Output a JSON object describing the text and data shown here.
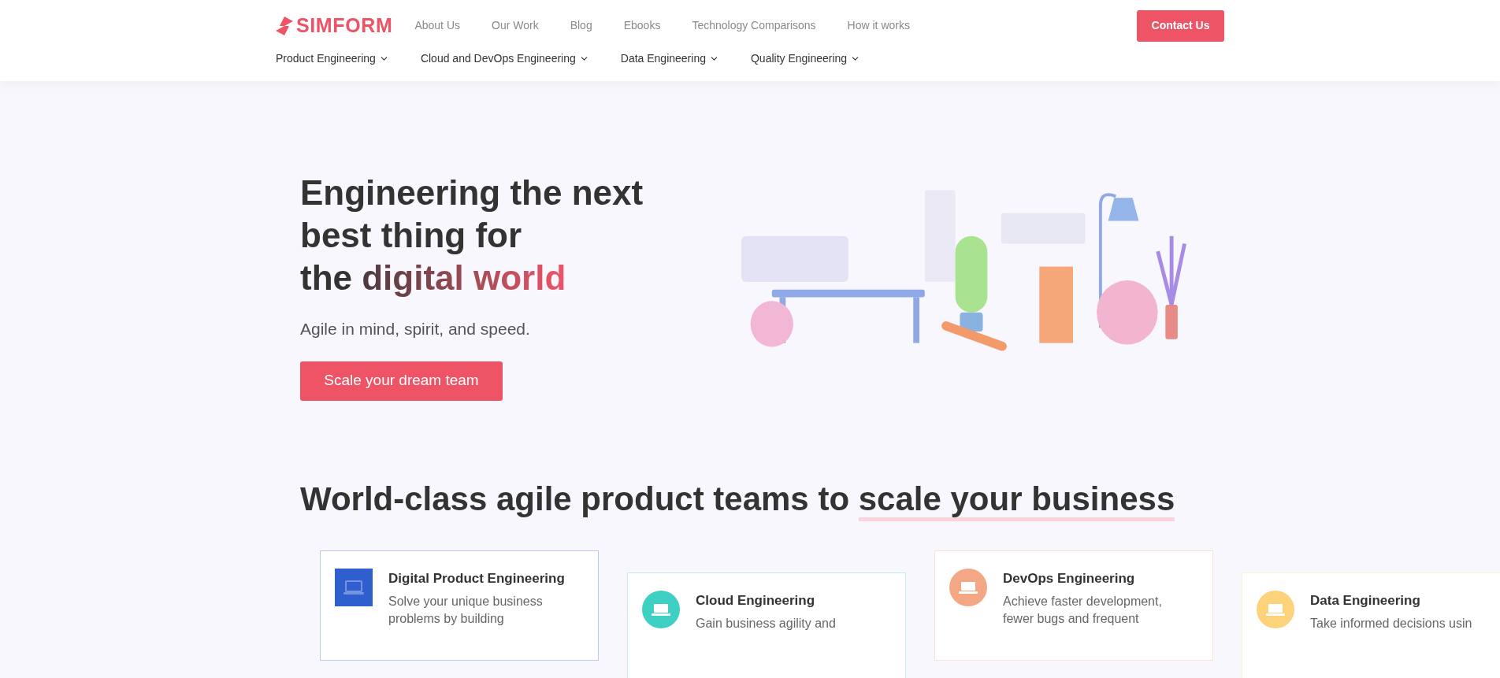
{
  "header": {
    "logo": "SIMFORM",
    "top_links": [
      "About Us",
      "Our Work",
      "Blog",
      "Ebooks",
      "Technology Comparisons",
      "How it works"
    ],
    "cta": "Contact Us",
    "menus": [
      "Product Engineering",
      "Cloud and DevOps Engineering",
      "Data Engineering",
      "Quality Engineering"
    ]
  },
  "hero": {
    "heading_lines": [
      "Engineering the next",
      "best thing for"
    ],
    "heading_last": "the",
    "heading_highlight": "digital world",
    "subtitle": "Agile in mind, spirit, and speed.",
    "button": "Scale your dream team"
  },
  "section": {
    "heading": "World-class agile product teams to",
    "heading_underlined": "scale your business"
  },
  "cards": [
    {
      "title": "Digital Product Engineering",
      "description": [
        "Solve your unique business",
        "problems by building"
      ],
      "color": "#2f5fce",
      "kind": "square"
    },
    {
      "title": "Cloud Engineering",
      "description": [
        "Gain business agility and"
      ],
      "color": "#3fd0c4",
      "kind": "circle"
    },
    {
      "title": "DevOps Engineering",
      "description": [
        "Achieve faster development,",
        "fewer bugs and frequent"
      ],
      "color": "#f4a784",
      "kind": "circle"
    },
    {
      "title": "Data Engineering",
      "description": [
        "Take informed decisions usin"
      ],
      "color": "#fcd27a",
      "kind": "circle"
    }
  ]
}
